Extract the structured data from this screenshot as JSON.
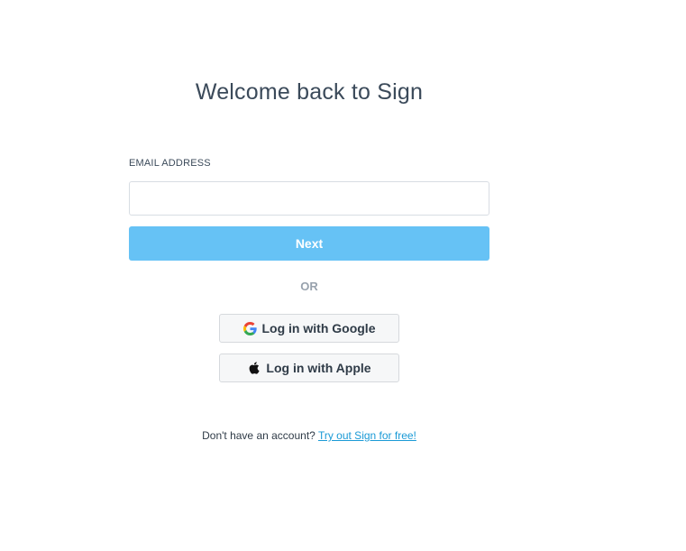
{
  "login": {
    "title": "Welcome back to Sign",
    "email_label": "EMAIL ADDRESS",
    "email_value": "",
    "email_placeholder": "",
    "next_label": "Next",
    "or_label": "OR",
    "google_label": "Log in with Google",
    "apple_label": "Log in with Apple",
    "signup_prompt": "Don't have an account?",
    "signup_link": "Try out Sign for free!"
  },
  "colors": {
    "primary_button": "#66c2f5",
    "link": "#1a9ad6",
    "text": "#3b4a5a"
  },
  "icons": {
    "google": "google-icon",
    "apple": "apple-icon"
  }
}
